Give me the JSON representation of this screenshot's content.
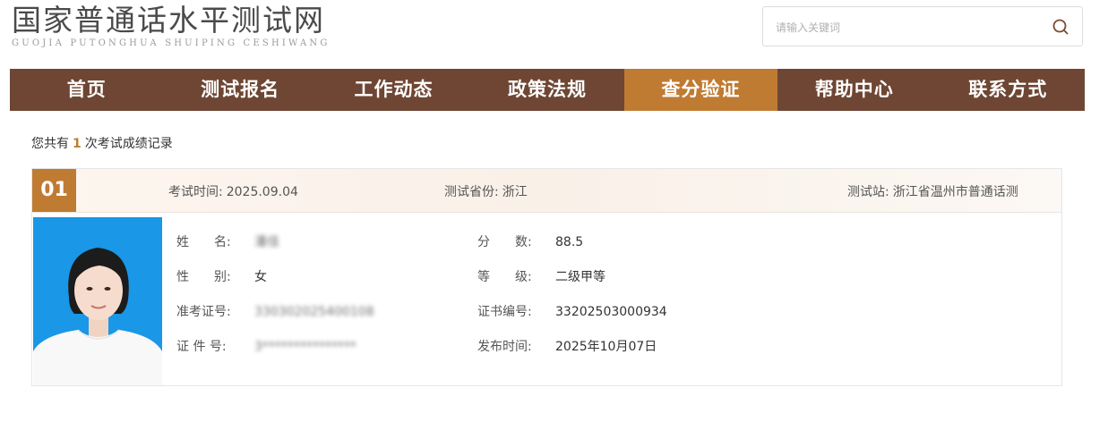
{
  "header": {
    "logo_cn": "国家普通话水平测试网",
    "logo_en": "GUOJIA PUTONGHUA SHUIPING CESHIWANG",
    "search_placeholder": "请输入关键词"
  },
  "nav": {
    "items": [
      {
        "label": "首页"
      },
      {
        "label": "测试报名"
      },
      {
        "label": "工作动态"
      },
      {
        "label": "政策法规"
      },
      {
        "label": "查分验证"
      },
      {
        "label": "帮助中心"
      },
      {
        "label": "联系方式"
      }
    ],
    "active_index": 4
  },
  "summary": {
    "prefix": "您共有",
    "count": "1",
    "suffix": "次考试成绩记录"
  },
  "record": {
    "index": "01",
    "exam_time_label": "考试时间:",
    "exam_time": "2025.09.04",
    "province_label": "测试省份:",
    "province": "浙江",
    "station_label": "测试站:",
    "station": "浙江省温州市普通话测",
    "name_label": "姓　　名:",
    "name": "潘佳",
    "gender_label": "性　　别:",
    "gender": "女",
    "ticket_label": "准考证号:",
    "ticket": "330302025400108",
    "id_label": "证 件 号:",
    "id": "3***************",
    "score_label": "分　　数:",
    "score": "88.5",
    "level_label": "等　　级:",
    "level": "二级甲等",
    "cert_label": "证书编号:",
    "cert": "33202503000934",
    "publish_label": "发布时间:",
    "publish": "2025年10月07日"
  },
  "colors": {
    "nav_bg": "#6e4633",
    "nav_active": "#c07b33",
    "accent": "#c07b33"
  }
}
